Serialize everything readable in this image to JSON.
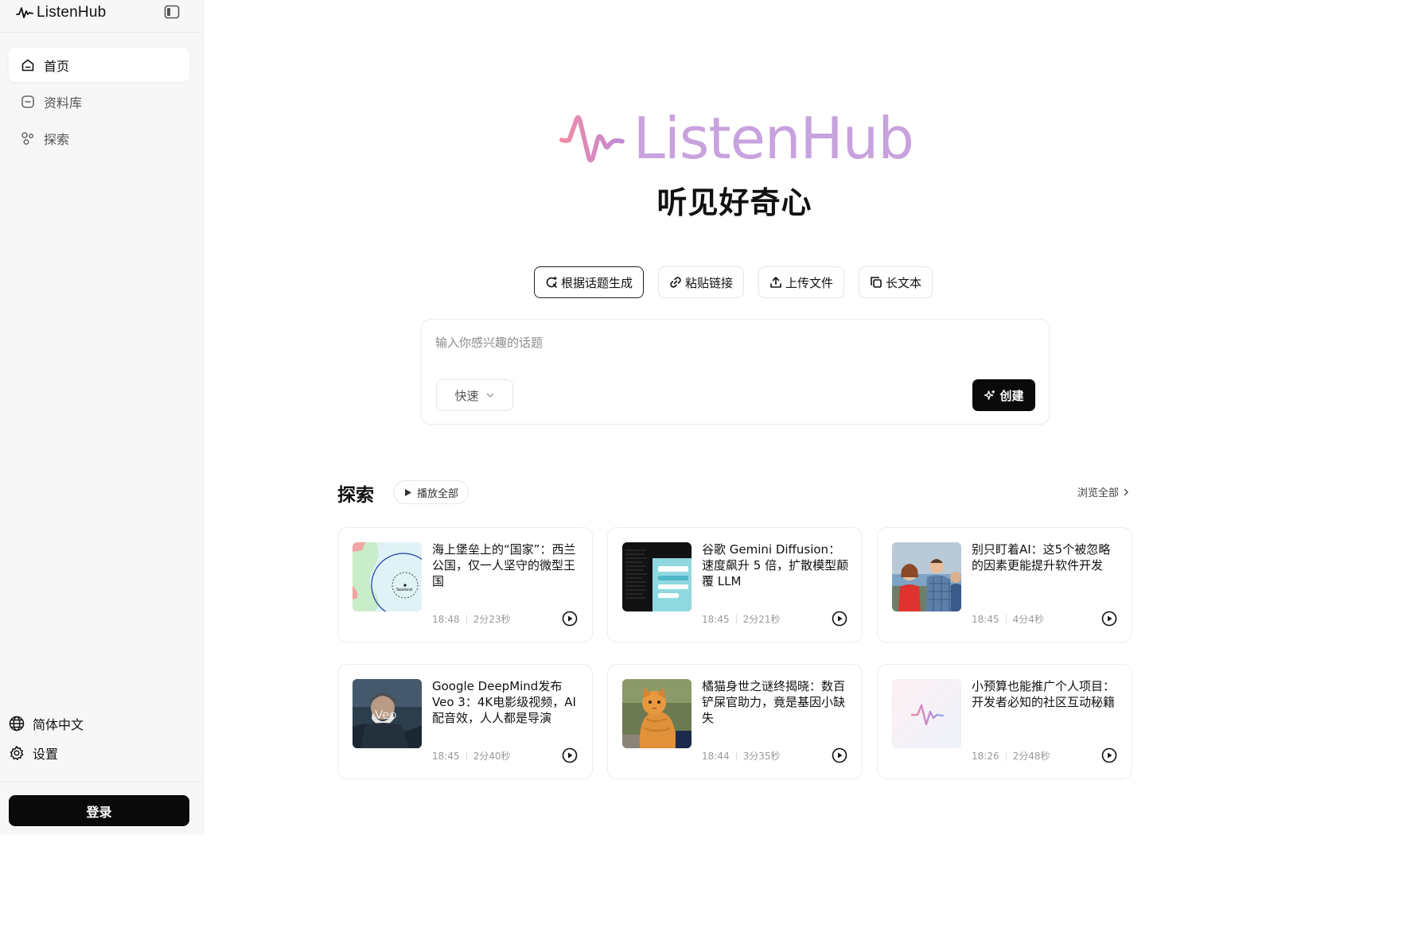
{
  "app": {
    "name": "ListenHub"
  },
  "sidebar": {
    "items": [
      {
        "label": "首页",
        "icon": "home-icon",
        "active": true
      },
      {
        "label": "资料库",
        "icon": "library-icon",
        "active": false
      },
      {
        "label": "探索",
        "icon": "explore-icon",
        "active": false
      }
    ],
    "language": "简体中文",
    "settings": "设置",
    "login": "登录"
  },
  "hero": {
    "logo_text": "ListenHub",
    "tagline": "听见好奇心"
  },
  "modes": [
    {
      "label": "根据话题生成",
      "icon": "topic-generate-icon",
      "active": true
    },
    {
      "label": "粘贴链接",
      "icon": "link-icon",
      "active": false
    },
    {
      "label": "上传文件",
      "icon": "upload-icon",
      "active": false
    },
    {
      "label": "长文本",
      "icon": "copy-text-icon",
      "active": false
    }
  ],
  "prompt": {
    "placeholder": "输入你感兴趣的话题",
    "value": "",
    "speed": "快速",
    "create": "创建"
  },
  "explore": {
    "title": "探索",
    "play_all": "播放全部",
    "browse_all": "浏览全部",
    "cards": [
      {
        "title": "海上堡垒上的“国家”：西兰公国，仅一人坚守的微型王国",
        "time": "18:48",
        "duration": "2分23秒",
        "thumb": "map-thumbnail",
        "thumb_label": "Sealand"
      },
      {
        "title": "谷歌 Gemini Diffusion：速度飙升 5 倍，扩散模型颠覆 LLM",
        "time": "18:45",
        "duration": "2分21秒",
        "thumb": "screen-thumbnail"
      },
      {
        "title": "别只盯着AI：这5个被忽略的因素更能提升软件开发",
        "time": "18:45",
        "duration": "4分4秒",
        "thumb": "meme-thumbnail"
      },
      {
        "title": "Google DeepMind发布Veo 3：4K电影级视频，AI配音效，人人都是导演",
        "time": "18:45",
        "duration": "2分40秒",
        "thumb": "veo-thumbnail",
        "thumb_label": "Veo"
      },
      {
        "title": "橘猫身世之谜终揭晓：数百铲屎官助力，竟是基因小缺失",
        "time": "18:44",
        "duration": "3分35秒",
        "thumb": "cat-thumbnail"
      },
      {
        "title": "小预算也能推广个人项目：开发者必知的社区互动秘籍",
        "time": "18:26",
        "duration": "2分48秒",
        "thumb": "wave-thumbnail"
      }
    ]
  },
  "colors": {
    "brand_pink": "#e88aa6",
    "brand_purple": "#c8a2de",
    "primary_button": "#0a0a0a"
  }
}
